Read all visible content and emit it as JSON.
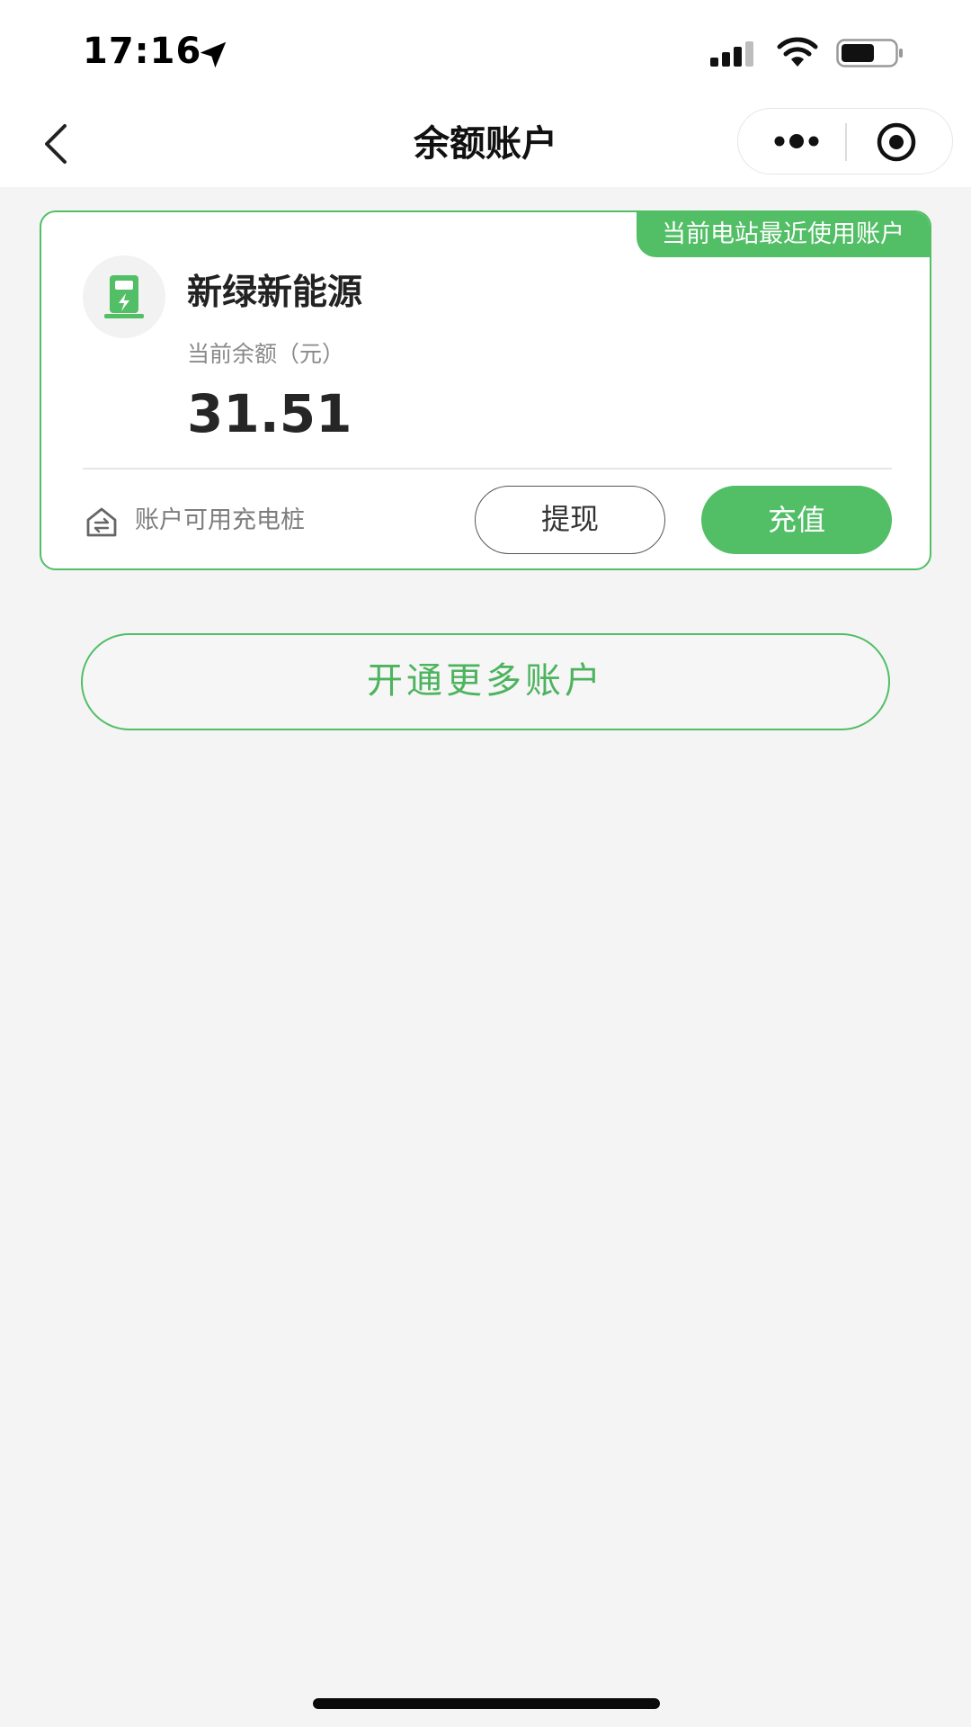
{
  "status_bar": {
    "time": "17:16"
  },
  "nav": {
    "title": "余额账户"
  },
  "account_card": {
    "badge": "当前电站最近使用账户",
    "name": "新绿新能源",
    "balance_label": "当前余额（元）",
    "balance_value": "31.51",
    "piles_link": "账户可用充电桩",
    "withdraw_label": "提现",
    "recharge_label": "充值"
  },
  "open_more_label": "开通更多账户",
  "colors": {
    "accent": "#52be66",
    "background": "#f4f4f4",
    "card": "#ffffff"
  }
}
